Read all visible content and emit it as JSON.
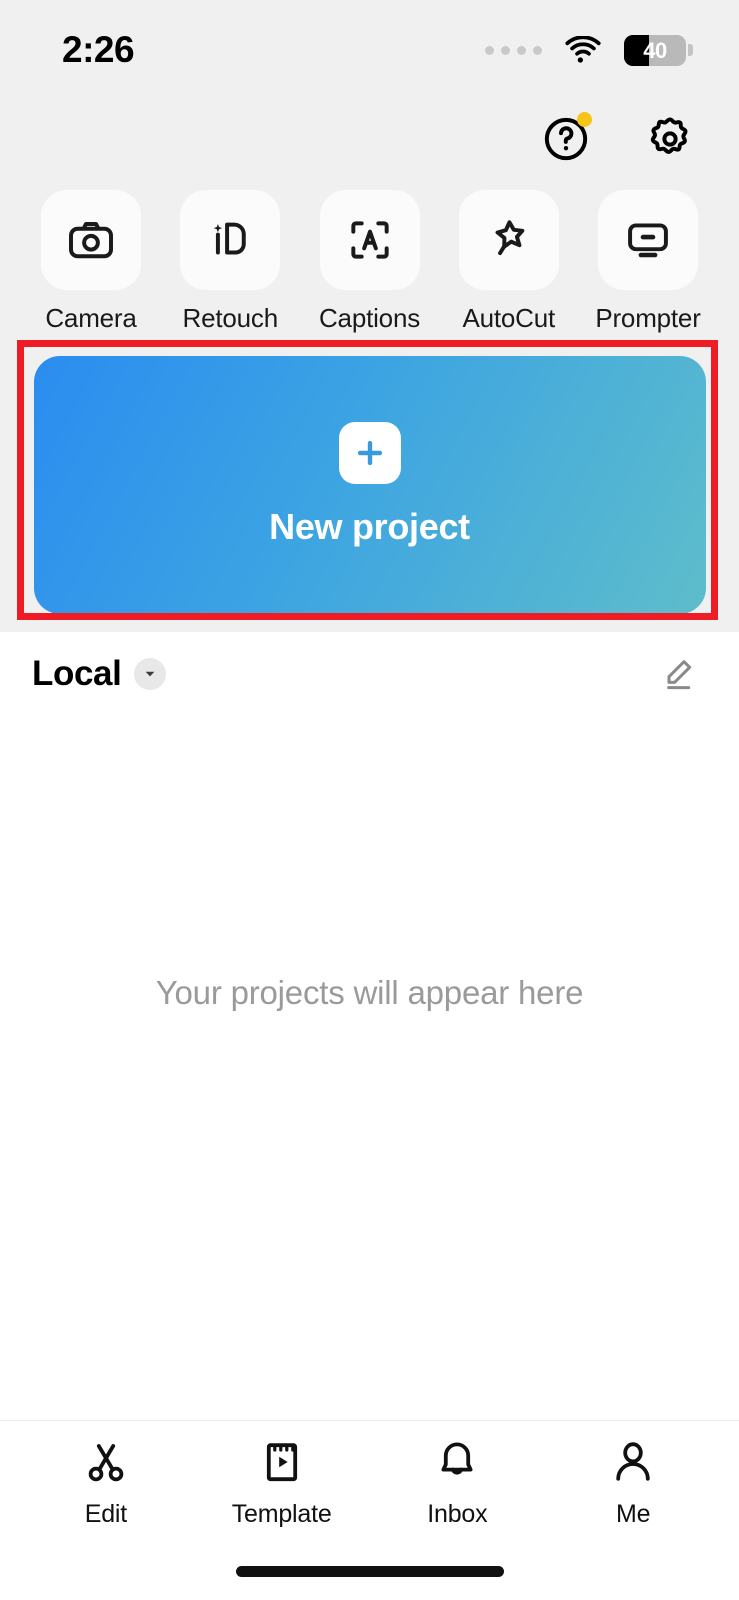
{
  "status_bar": {
    "time": "2:26",
    "signal_icon": "signal-dots-icon",
    "wifi_icon": "wifi-icon",
    "battery_level": "40",
    "battery_percent": 40
  },
  "header": {
    "help_icon": "help-circle-icon",
    "help_badge": true,
    "settings_icon": "gear-icon",
    "notification_dot_color": "#f5c518"
  },
  "tools": [
    {
      "label": "Camera",
      "icon": "camera-icon"
    },
    {
      "label": "Retouch",
      "icon": "retouch-icon"
    },
    {
      "label": "Captions",
      "icon": "captions-icon"
    },
    {
      "label": "AutoCut",
      "icon": "autocut-star-icon"
    },
    {
      "label": "Prompter",
      "icon": "prompter-monitor-icon"
    }
  ],
  "new_project": {
    "label": "New project",
    "plus_icon": "plus-icon",
    "gradient_start": "#2b8cf0",
    "gradient_end": "#5ebdcb",
    "highlight_color": "#ee1c24",
    "highlighted": true
  },
  "local_section": {
    "title": "Local",
    "caret_icon": "chevron-down-icon",
    "edit_icon": "pencil-edit-icon"
  },
  "empty_state": {
    "message": "Your projects will appear here"
  },
  "tabs": [
    {
      "label": "Edit",
      "icon": "scissors-icon",
      "active": true
    },
    {
      "label": "Template",
      "icon": "template-icon",
      "active": false
    },
    {
      "label": "Inbox",
      "icon": "bell-icon",
      "active": false
    },
    {
      "label": "Me",
      "icon": "person-icon",
      "active": false
    }
  ],
  "home_indicator": "home-indicator"
}
